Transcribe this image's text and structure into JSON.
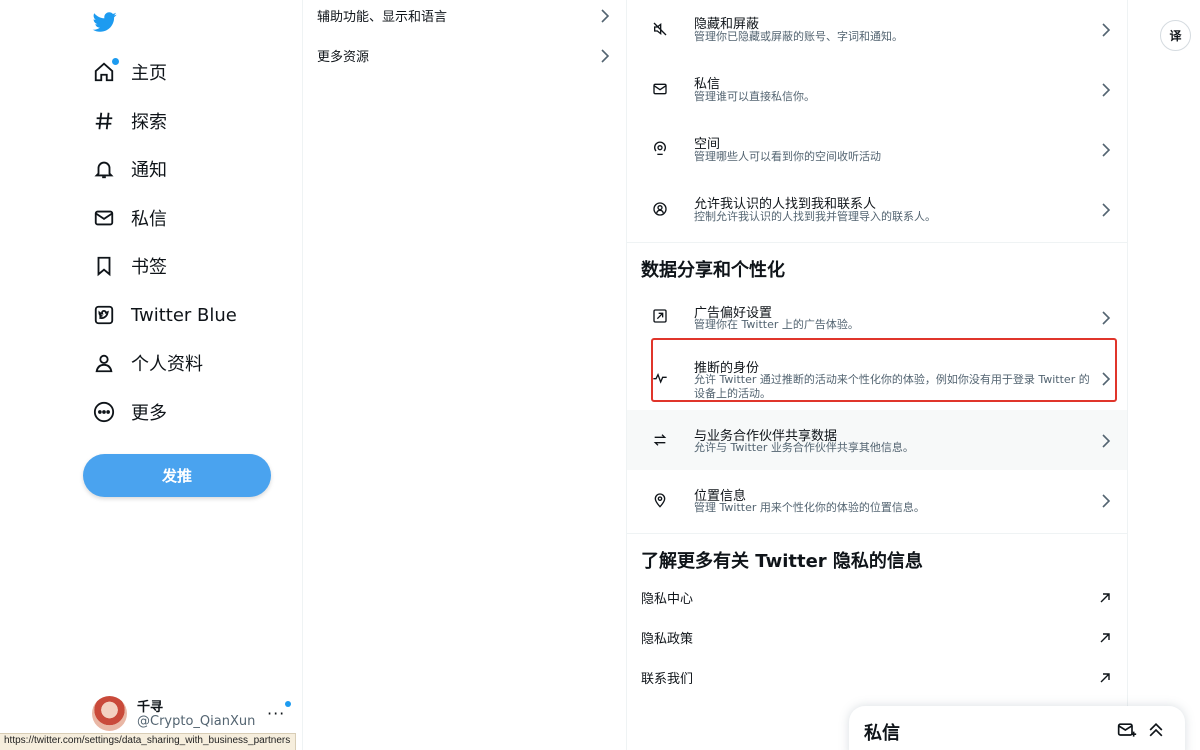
{
  "nav": {
    "items": [
      {
        "label": "主页",
        "icon": "home-icon"
      },
      {
        "label": "探索",
        "icon": "hashtag-icon"
      },
      {
        "label": "通知",
        "icon": "bell-icon"
      },
      {
        "label": "私信",
        "icon": "mail-icon"
      },
      {
        "label": "书签",
        "icon": "bookmark-icon"
      },
      {
        "label": "Twitter Blue",
        "icon": "twitter-blue-icon"
      },
      {
        "label": "个人资料",
        "icon": "profile-icon"
      },
      {
        "label": "更多",
        "icon": "more-circle-icon"
      }
    ],
    "tweet_button": "发推",
    "profile": {
      "name": "千寻",
      "handle": "@Crypto_QianXun",
      "more": "···"
    }
  },
  "settings_menu": {
    "items": [
      {
        "label": "辅助功能、显示和语言"
      },
      {
        "label": "更多资源"
      }
    ]
  },
  "privacy": {
    "rows_top": [
      {
        "title": "隐藏和屏蔽",
        "desc": "管理你已隐藏或屏蔽的账号、字词和通知。",
        "icon": "mute-icon"
      },
      {
        "title": "私信",
        "desc": "管理谁可以直接私信你。",
        "icon": "mail-icon"
      },
      {
        "title": "空间",
        "desc": "管理哪些人可以看到你的空间收听活动",
        "icon": "spaces-icon"
      },
      {
        "title": "允许我认识的人找到我和联系人",
        "desc": "控制允许我认识的人找到我并管理导入的联系人。",
        "icon": "discover-icon"
      }
    ],
    "section_data_title": "数据分享和个性化",
    "rows_data": [
      {
        "title": "广告偏好设置",
        "desc": "管理你在 Twitter 上的广告体验。",
        "icon": "ad-icon"
      },
      {
        "title": "推断的身份",
        "desc": "允许 Twitter 通过推断的活动来个性化你的体验，例如你没有用于登录 Twitter 的设备上的活动。",
        "icon": "activity-icon"
      },
      {
        "title": "与业务合作伙伴共享数据",
        "desc": "允许与 Twitter 业务合作伙伴共享其他信息。",
        "icon": "swap-icon"
      },
      {
        "title": "位置信息",
        "desc": "管理 Twitter 用来个性化你的体验的位置信息。",
        "icon": "location-icon"
      }
    ],
    "section_learn_title": "了解更多有关 Twitter 隐私的信息",
    "links": [
      {
        "label": "隐私中心"
      },
      {
        "label": "隐私政策"
      },
      {
        "label": "联系我们"
      }
    ]
  },
  "translate_button": "译",
  "dm_drawer": {
    "title": "私信"
  },
  "status_url": "https://twitter.com/settings/data_sharing_with_business_partners",
  "colors": {
    "accent": "#1d9bf0",
    "tweet_button": "#4aa3ef",
    "highlight_border": "#e0352b",
    "text_primary": "#0f1419",
    "text_secondary": "#536471"
  }
}
